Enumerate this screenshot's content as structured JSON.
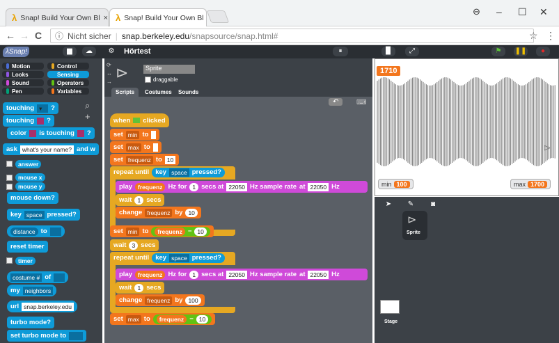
{
  "browser": {
    "tabs": [
      {
        "title": "Snap! Build Your Own Bl",
        "close": "×"
      },
      {
        "title": "Snap! Build Your Own Bl",
        "close": "×"
      }
    ],
    "nav": {
      "back": "←",
      "forward": "→",
      "reload": "C"
    },
    "address": {
      "security": "Nicht sicher",
      "host": "snap.berkeley.edu",
      "path": "/snapsource/snap.html#"
    },
    "star": "☆",
    "menu": "⋮",
    "window": {
      "minimize": "–",
      "maximize": "☐",
      "close": "✕"
    }
  },
  "snap": {
    "logo": "λSnap!",
    "project_name": "Hörtest",
    "categories": [
      {
        "label": "Motion",
        "color": "#4a6cd4"
      },
      {
        "label": "Control",
        "color": "#e6a822"
      },
      {
        "label": "Looks",
        "color": "#8f56e3"
      },
      {
        "label": "Sensing",
        "color": "#0e9bd8"
      },
      {
        "label": "Sound",
        "color": "#cf4ad9"
      },
      {
        "label": "Operators",
        "color": "#62c213"
      },
      {
        "label": "Pen",
        "color": "#00a178"
      },
      {
        "label": "Variables",
        "color": "#f3761d"
      }
    ],
    "palette": {
      "touching": "touching",
      "touching_q": "?",
      "color_is_touching": "is touching",
      "color_word": "color",
      "ask": "ask",
      "ask_default": "what's your name?",
      "and_wait": "and w",
      "answer": "answer",
      "mouse_x": "mouse x",
      "mouse_y": "mouse y",
      "mouse_down": "mouse down?",
      "key": "key",
      "key_space": "space",
      "pressed": "pressed?",
      "distance": "distance",
      "to": "to",
      "reset_timer": "reset timer",
      "timer": "timer",
      "costume": "costume #",
      "of": "of",
      "my": "my",
      "neighbors": "neighbors",
      "url": "url",
      "url_value": "snap.berkeley.edu",
      "turbo": "turbo mode?",
      "set_turbo": "set turbo mode to"
    },
    "sprite_name": "Sprite",
    "draggable": "draggable",
    "editor_tabs": [
      "Scripts",
      "Costumes",
      "Sounds"
    ],
    "script": {
      "when": "when",
      "clicked": "clicked",
      "set": "set",
      "to": "to",
      "min": "min",
      "max": "max",
      "frequenz": "frequenz",
      "ten": "10",
      "repeat_until": "repeat until",
      "key": "key",
      "space": "space",
      "pressed": "pressed?",
      "play": "play",
      "hz_for": "Hz for",
      "one": "1",
      "secs_at": "secs at",
      "rate": "22050",
      "hz_sample_rate": "Hz sample rate",
      "at": "at",
      "hz": "Hz",
      "wait": "wait",
      "secs": "secs",
      "change": "change",
      "by": "by",
      "minus": "−",
      "three": "3",
      "hundred": "100"
    },
    "stage": {
      "readout": "1710",
      "min_label": "min",
      "min_value": "100",
      "max_label": "max",
      "max_value": "1700"
    },
    "corral": {
      "sprite": "Sprite",
      "stage": "Stage"
    }
  }
}
